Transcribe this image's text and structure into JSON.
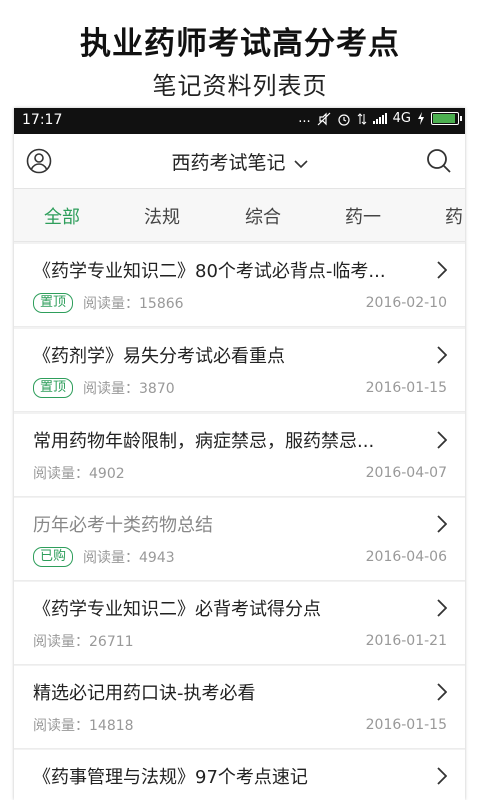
{
  "promo": {
    "title": "执业药师考试高分考点",
    "subtitle": "笔记资料列表页"
  },
  "status_bar": {
    "time": "17:17",
    "dots": "...",
    "network": "4G"
  },
  "app_bar": {
    "title": "西药考试笔记"
  },
  "tabs": [
    {
      "label": "全部",
      "active": true
    },
    {
      "label": "法规",
      "active": false
    },
    {
      "label": "综合",
      "active": false
    },
    {
      "label": "药一",
      "active": false
    },
    {
      "label": "药",
      "active": false
    }
  ],
  "notes": [
    {
      "title": "《药学专业知识二》80个考试必背点-临考...",
      "badge": "置顶",
      "reads_label": "阅读量：15866",
      "date": "2016-02-10",
      "read": false
    },
    {
      "title": "《药剂学》易失分考试必看重点",
      "badge": "置顶",
      "reads_label": "阅读量：3870",
      "date": "2016-01-15",
      "read": false
    },
    {
      "title": "常用药物年龄限制，病症禁忌，服药禁忌...",
      "badge": "",
      "reads_label": "阅读量：4902",
      "date": "2016-04-07",
      "read": false
    },
    {
      "title": "历年必考十类药物总结",
      "badge": "已购",
      "reads_label": "阅读量：4943",
      "date": "2016-04-06",
      "read": true
    },
    {
      "title": "《药学专业知识二》必背考试得分点",
      "badge": "",
      "reads_label": "阅读量：26711",
      "date": "2016-01-21",
      "read": false
    },
    {
      "title": "精选必记用药口诀-执考必看",
      "badge": "",
      "reads_label": "阅读量：14818",
      "date": "2016-01-15",
      "read": false
    },
    {
      "title": "《药事管理与法规》97个考点速记",
      "badge": "",
      "reads_label": "",
      "date": "",
      "read": false
    }
  ],
  "colors": {
    "accent": "#2e9e5b",
    "status_bar": "#111111"
  }
}
